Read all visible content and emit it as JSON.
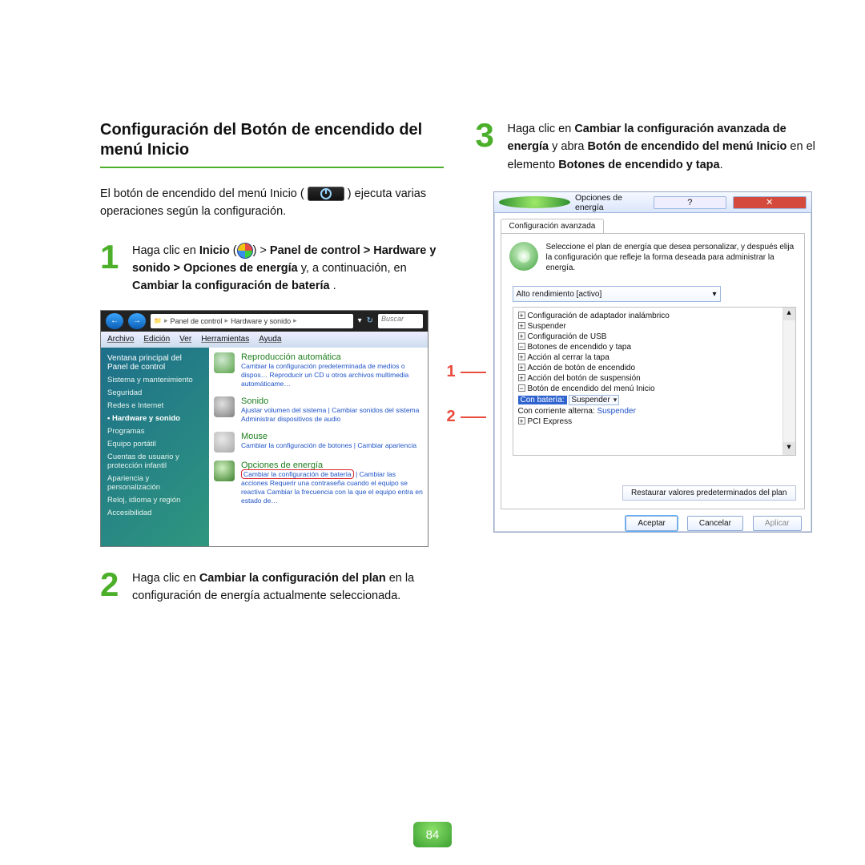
{
  "section_title": "Configuración del Botón de encendido del menú Inicio",
  "intro_pre": "El botón de encendido del menú Inicio (",
  "intro_post": ") ejecuta varias operaciones según la configuración.",
  "steps": {
    "1": {
      "pre": "Haga clic en ",
      "inicio": "Inicio",
      "mid": " (",
      "post_orb": ") > ",
      "bold1": "Panel de control > Hardware y sonido > Opciones de energía",
      "rest1": " y, a continuación, en ",
      "bold2": "Cambiar la configuración de batería",
      "tail": " ."
    },
    "2": {
      "pre": "Haga clic en ",
      "bold": "Cambiar la configuración del plan",
      "rest": " en la configuración de energía actualmente seleccionada."
    },
    "3": {
      "pre": "Haga clic en ",
      "b1": "Cambiar la configuración avanzada de energía",
      "mid1": " y abra ",
      "b2": "Botón de encendido del menú Inicio",
      "mid2": " en el elemento ",
      "b3": "Botones de encendido y tapa",
      "tail": "."
    }
  },
  "cp": {
    "breadcrumb": [
      "Panel de control",
      "Hardware y sonido"
    ],
    "search_ph": "Buscar",
    "menu": [
      "Archivo",
      "Edición",
      "Ver",
      "Herramientas",
      "Ayuda"
    ],
    "side_header": "Ventana principal del Panel de control",
    "side_items": [
      "Sistema y mantenimiento",
      "Seguridad",
      "Redes e Internet",
      "Hardware y sonido",
      "Programas",
      "Equipo portátil",
      "Cuentas de usuario y protección infantil",
      "Apariencia y personalización",
      "Reloj, idioma y región",
      "Accesibilidad"
    ],
    "cats": {
      "repro": {
        "t": "Reproducción automática",
        "s": "Cambiar la configuración predeterminada de medios o dispos…  Reproducir un CD u otros archivos multimedia automáticame…"
      },
      "sonido": {
        "t": "Sonido",
        "s": "Ajustar volumen del sistema   |   Cambiar sonidos del sistema   Administrar dispositivos de audio"
      },
      "mouse": {
        "t": "Mouse",
        "s": "Cambiar la configuración de botones   |   Cambiar apariencia"
      },
      "energia": {
        "t": "Opciones de energía",
        "ringed": "Cambiar la configuración de batería",
        "after": "   |   Cambiar las acciones   Requerir una contraseña cuando el equipo se reactiva   Cambiar la frecuencia con la que el equipo entra en estado de…"
      }
    }
  },
  "po": {
    "title": "Opciones de energía",
    "tab": "Configuración avanzada",
    "desc": "Seleccione el plan de energía que desea personalizar, y después elija la configuración que refleje la forma deseada para administrar la energía.",
    "plan": "Alto rendimiento [activo]",
    "tree": {
      "n1": "Configuración de adaptador inalámbrico",
      "n2": "Suspender",
      "n3": "Configuración de USB",
      "n4": "Botones de encendido y tapa",
      "n4a": "Acción al cerrar la tapa",
      "n4b": "Acción de botón de encendido",
      "n4c": "Acción del botón de suspensión",
      "n4d": "Botón de encendido del menú Inicio",
      "bat_lbl": "Con batería:",
      "bat_val": "Suspender",
      "ac_lbl": "Con corriente alterna:",
      "ac_val": "Suspender",
      "n5": "PCI Express"
    },
    "restore": "Restaurar valores predeterminados del plan",
    "ok": "Aceptar",
    "cancel": "Cancelar",
    "apply": "Aplicar"
  },
  "page_number": "84",
  "callout_1": "1",
  "callout_2": "2"
}
